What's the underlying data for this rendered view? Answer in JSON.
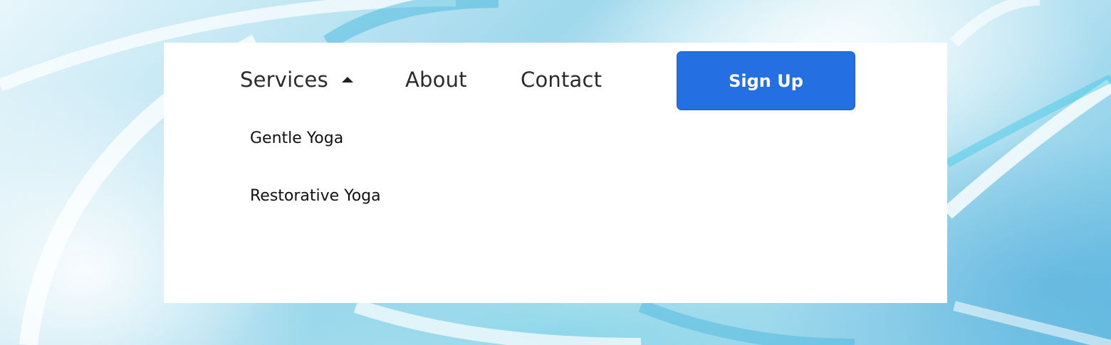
{
  "nav": {
    "items": [
      {
        "label": "Services",
        "icon": "caret-up-icon",
        "expanded": true
      },
      {
        "label": "About"
      },
      {
        "label": "Contact"
      }
    ],
    "signup_label": "Sign Up"
  },
  "dropdown": {
    "items": [
      {
        "label": "Gentle Yoga"
      },
      {
        "label": "Restorative Yoga"
      }
    ]
  },
  "colors": {
    "button": "#2470e2",
    "panel": "#ffffff",
    "text": "#2b2b2b"
  }
}
